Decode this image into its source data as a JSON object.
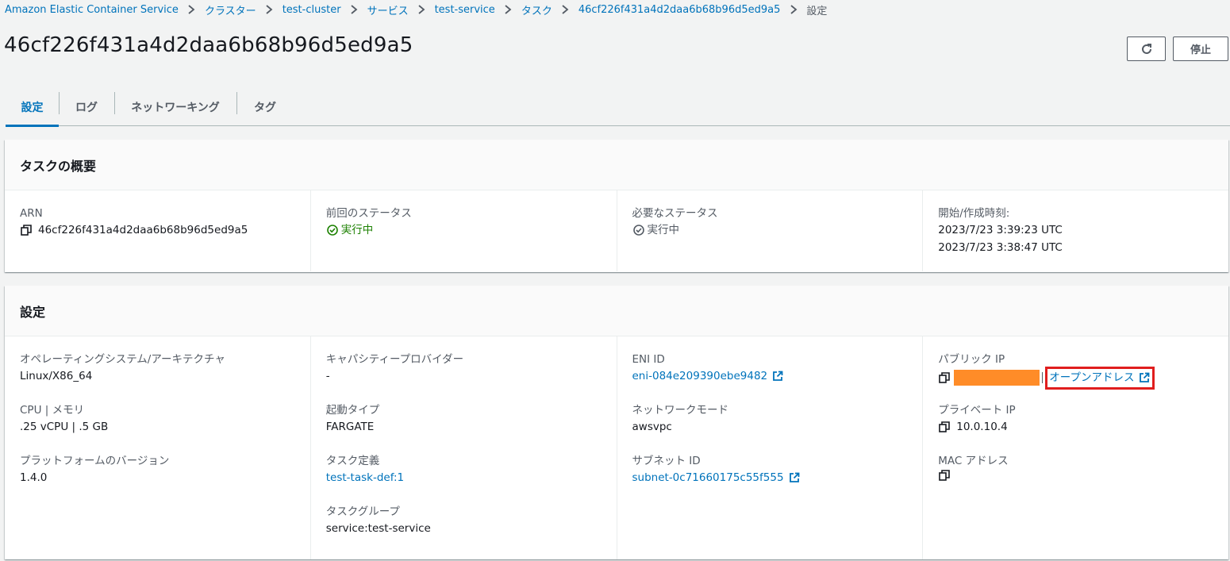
{
  "breadcrumb": [
    {
      "label": "Amazon Elastic Container Service"
    },
    {
      "label": "クラスター"
    },
    {
      "label": "test-cluster"
    },
    {
      "label": "サービス"
    },
    {
      "label": "test-service"
    },
    {
      "label": "タスク"
    },
    {
      "label": "46cf226f431a4d2daa6b68b96d5ed9a5"
    },
    {
      "label": "設定"
    }
  ],
  "page": {
    "title": "46cf226f431a4d2daa6b68b96d5ed9a5",
    "stop_label": "停止"
  },
  "tabs": [
    {
      "label": "設定",
      "active": true
    },
    {
      "label": "ログ"
    },
    {
      "label": "ネットワーキング"
    },
    {
      "label": "タグ"
    }
  ],
  "overview": {
    "title": "タスクの概要",
    "arn_label": "ARN",
    "arn_value": "46cf226f431a4d2daa6b68b96d5ed9a5",
    "last_status_label": "前回のステータス",
    "last_status_value": "実行中",
    "desired_status_label": "必要なステータス",
    "desired_status_value": "実行中",
    "started_label": "開始/作成時刻:",
    "started_value": "2023/7/23 3:39:23 UTC",
    "created_value": "2023/7/23 3:38:47 UTC"
  },
  "config": {
    "title": "設定",
    "os_label": "オペレーティングシステム/アーキテクチャ",
    "os_value": "Linux/X86_64",
    "cpu_label": "CPU | メモリ",
    "cpu_value": ".25 vCPU | .5 GB",
    "platform_label": "プラットフォームのバージョン",
    "platform_value": "1.4.0",
    "capacity_label": "キャパシティープロバイダー",
    "capacity_value": "-",
    "launch_label": "起動タイプ",
    "launch_value": "FARGATE",
    "taskdef_label": "タスク定義",
    "taskdef_value": "test-task-def:1",
    "group_label": "タスクグループ",
    "group_value": "service:test-service",
    "eni_label": "ENI ID",
    "eni_value": "eni-084e209390ebe9482",
    "netmode_label": "ネットワークモード",
    "netmode_value": "awsvpc",
    "subnet_label": "サブネット ID",
    "subnet_value": "subnet-0c71660175c55f555",
    "public_ip_label": "パブリック IP",
    "open_address_label": "オープンアドレス",
    "private_ip_label": "プライベート IP",
    "private_ip_value": "10.0.10.4",
    "mac_label": "MAC アドレス"
  },
  "colors": {
    "link": "#0073bb",
    "success": "#1d8102",
    "highlight": "#e01e1e",
    "redaction": "#ff8c28"
  },
  "icons": [
    "chevron-right-icon",
    "refresh-icon",
    "copy-icon",
    "status-positive-icon",
    "status-stopped-icon",
    "external-link-icon"
  ]
}
